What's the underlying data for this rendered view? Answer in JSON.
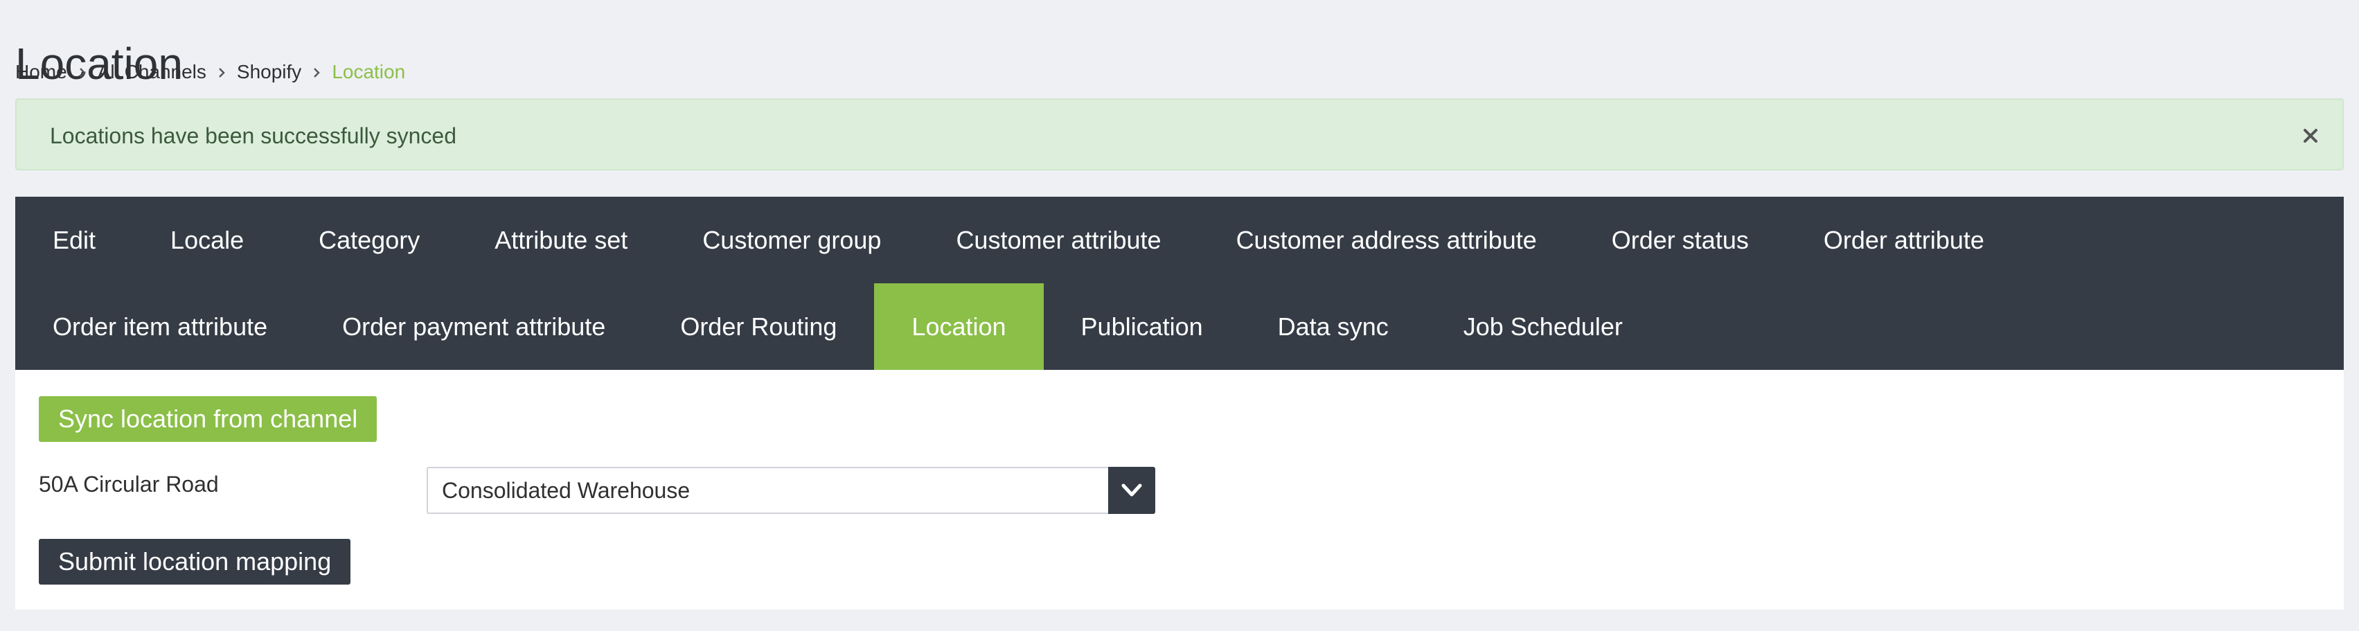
{
  "page": {
    "title": "Location"
  },
  "breadcrumb": [
    {
      "label": "Home"
    },
    {
      "label": "All Channels"
    },
    {
      "label": "Shopify"
    },
    {
      "label": "Location"
    }
  ],
  "alert": {
    "message": "Locations have been successfully synced",
    "close_icon": "close-icon"
  },
  "tabs": {
    "row1": [
      "Edit",
      "Locale",
      "Category",
      "Attribute set",
      "Customer group",
      "Customer attribute",
      "Customer address attribute",
      "Order status",
      "Order attribute"
    ],
    "row2": [
      "Order item attribute",
      "Order payment attribute",
      "Order Routing",
      "Location",
      "Publication",
      "Data sync",
      "Job Scheduler"
    ],
    "active": "Location"
  },
  "panel": {
    "sync_button": "Sync location from channel",
    "mapping": {
      "label": "50A Circular Road",
      "selected": "Consolidated Warehouse"
    },
    "submit_button": "Submit location mapping"
  },
  "colors": {
    "accent": "#8bbf48",
    "dark": "#353c46",
    "alert_bg": "#ddeedd",
    "page_bg": "#eff0f4"
  }
}
